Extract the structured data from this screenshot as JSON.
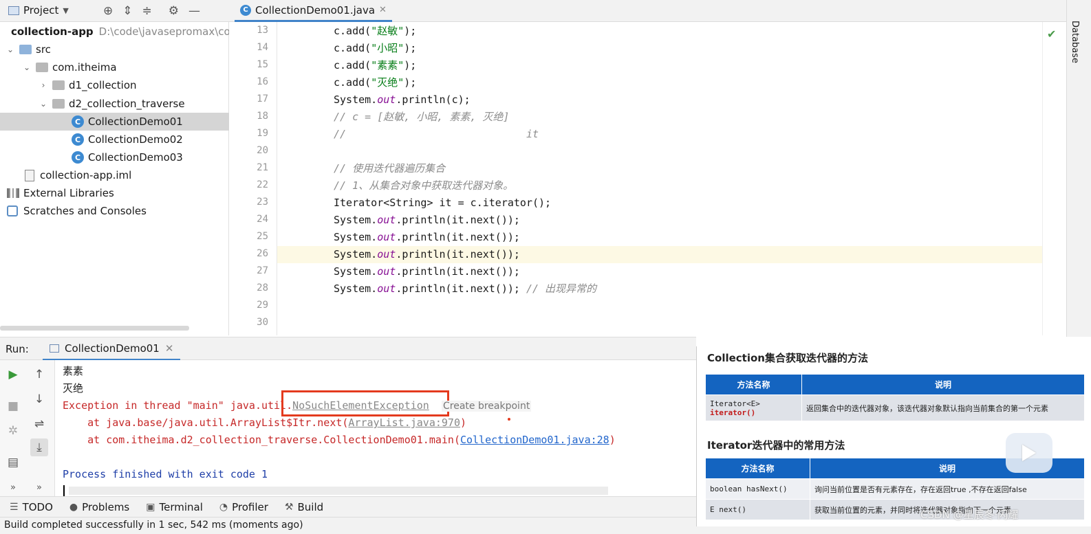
{
  "project_header": {
    "title": "Project"
  },
  "tree": {
    "root_name": "collection-app",
    "root_path": "D:\\code\\javasepromax\\colle",
    "src": "src",
    "package": "com.itheima",
    "d1": "d1_collection",
    "d2": "d2_collection_traverse",
    "class1": "CollectionDemo01",
    "class2": "CollectionDemo02",
    "class3": "CollectionDemo03",
    "iml": "collection-app.iml",
    "libs": "External Libraries",
    "scratches": "Scratches and Consoles"
  },
  "editor": {
    "tab": "CollectionDemo01.java",
    "side_label": "Database",
    "line_numbers": [
      "13",
      "14",
      "15",
      "16",
      "17",
      "18",
      "19",
      "20",
      "21",
      "22",
      "23",
      "24",
      "25",
      "26",
      "27",
      "28",
      "29",
      "30"
    ],
    "code": {
      "l13a": "c.add(",
      "l13s": "\"赵敏\"",
      "l13b": ");",
      "l14a": "c.add(",
      "l14s": "\"小昭\"",
      "l14b": ");",
      "l15a": "c.add(",
      "l15s": "\"素素\"",
      "l15b": ");",
      "l16a": "c.add(",
      "l16s": "\"灭绝\"",
      "l16b": ");",
      "l17a": "System.",
      "l17f": "out",
      "l17b": ".println(c);",
      "l18": "// c = [赵敏, 小昭, 素素, 灭绝]",
      "l19": "//                             it",
      "l21": "// 使用迭代器遍历集合",
      "l22": "// 1、从集合对象中获取迭代器对象。",
      "l23": "Iterator<String> it = c.iterator();",
      "println_a": "System.",
      "println_f": "out",
      "println_b": ".println(it.next());",
      "l28c": " // 出现异常的"
    }
  },
  "run": {
    "label": "Run:",
    "tab": "CollectionDemo01",
    "out1": "素素",
    "out2": "灭绝",
    "exc_prefix": "Exception in thread \"main\" java.util.",
    "exc_name": "NoSuchElementException",
    "create_bp": "Create breakpoint",
    "st1_prefix": "    at java.base/java.util.ArrayList$Itr.next(",
    "st1_link": "ArrayList.java:970",
    "st1_suffix": ")",
    "st2_prefix": "    at com.itheima.d2_collection_traverse.CollectionDemo01.main(",
    "st2_link": "CollectionDemo01.java:28",
    "st2_suffix": ")",
    "finish": "Process finished with exit code 1"
  },
  "toolbar": {
    "todo": "TODO",
    "problems": "Problems",
    "terminal": "Terminal",
    "profiler": "Profiler",
    "build": "Build"
  },
  "status": "Build completed successfully in 1 sec, 542 ms (moments ago)",
  "overlay": {
    "title1": "Collection集合获取迭代器的方法",
    "t1_head_name": "方法名称",
    "t1_head_desc": "说明",
    "t1_row_method_a": "Iterator<E> ",
    "t1_row_method_b": "iterator()",
    "t1_row_desc": "返回集合中的迭代器对象，该迭代器对象默认指向当前集合的第一个元素",
    "title2": "Iterator迭代器中的常用方法",
    "t2_head_name": "方法名称",
    "t2_head_desc": "说明",
    "t2_r1_method": "boolean hasNext()",
    "t2_r1_desc": "询问当前位置是否有元素存在，存在返回true ,不存在返回false",
    "t2_r2_method": "E next()",
    "t2_r2_desc": "获取当前位置的元素，并同时将迭代器对象指向下一个元素"
  },
  "watermark": "CSDN @星辰冬·闪耀"
}
